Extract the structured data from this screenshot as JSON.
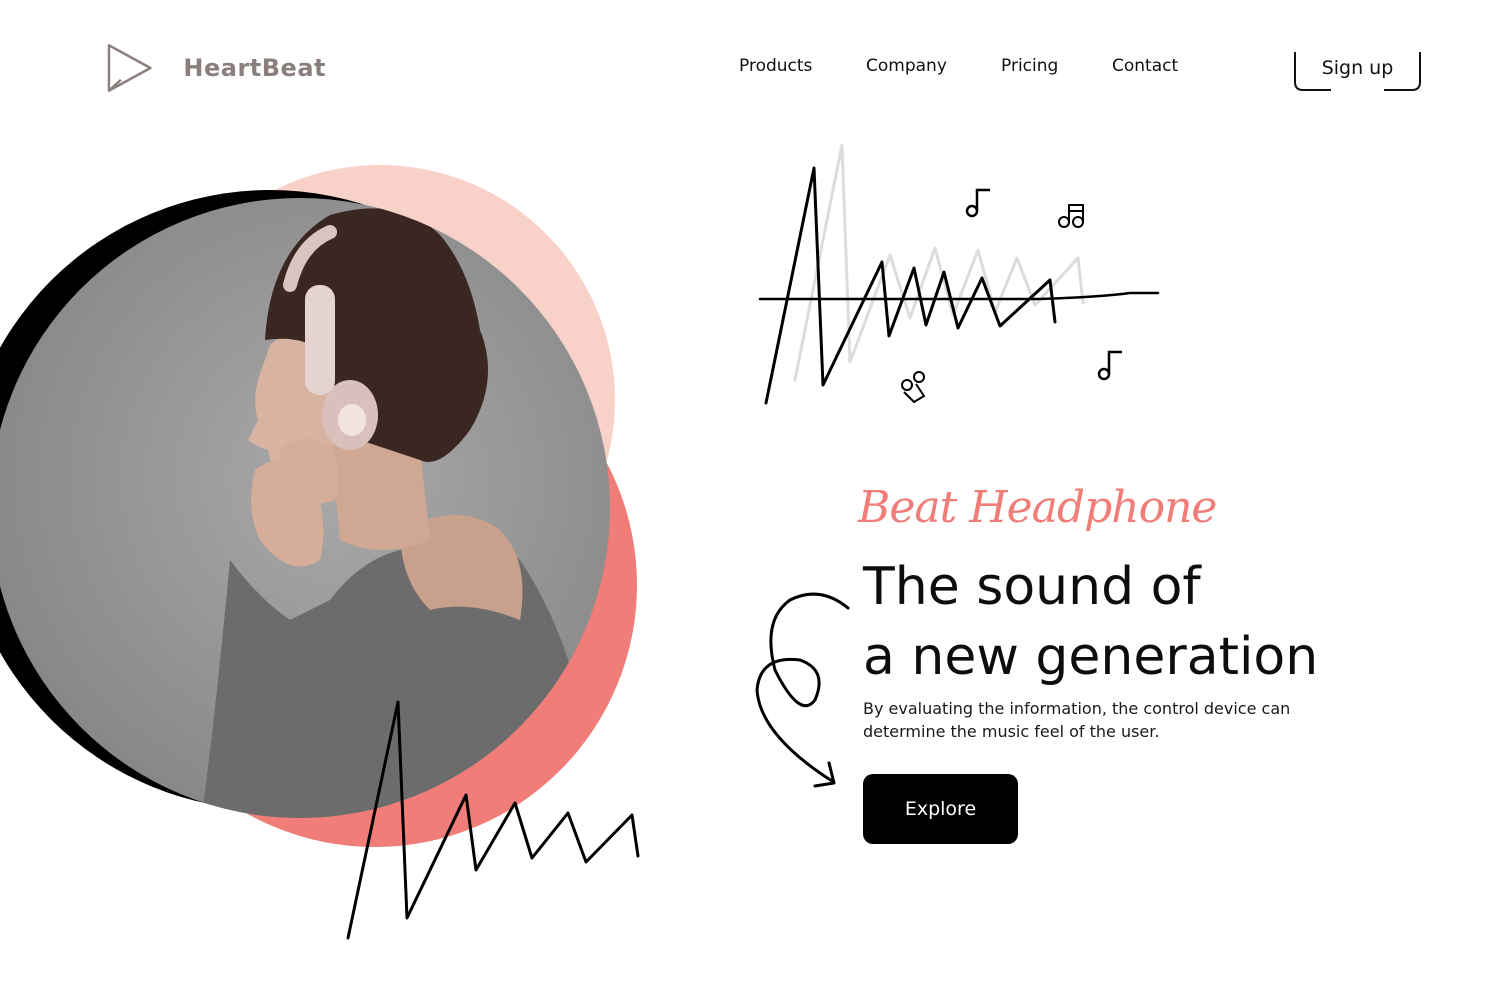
{
  "brand": {
    "name": "HeartBeat",
    "icon": "play-triangle-icon"
  },
  "nav": {
    "items": [
      {
        "label": "Products"
      },
      {
        "label": "Company"
      },
      {
        "label": "Pricing"
      },
      {
        "label": "Contact"
      }
    ],
    "signup_label": "Sign up"
  },
  "hero": {
    "subtitle": "Beat Headphone",
    "headline_line1": "The sound of",
    "headline_line2": "a new generation",
    "description": "By evaluating the information, the control device can determine the music feel of the user.",
    "cta_label": "Explore",
    "image": "woman-with-headphones-photo"
  },
  "colors": {
    "accent_coral": "#f07d78",
    "accent_pink": "#f8d1c9",
    "brand_gray": "#8a7f7d",
    "button_bg": "#000000"
  },
  "decorations": {
    "notes": [
      "music-note-icon",
      "double-music-note-icon",
      "music-note-icon",
      "music-note-icon"
    ]
  }
}
